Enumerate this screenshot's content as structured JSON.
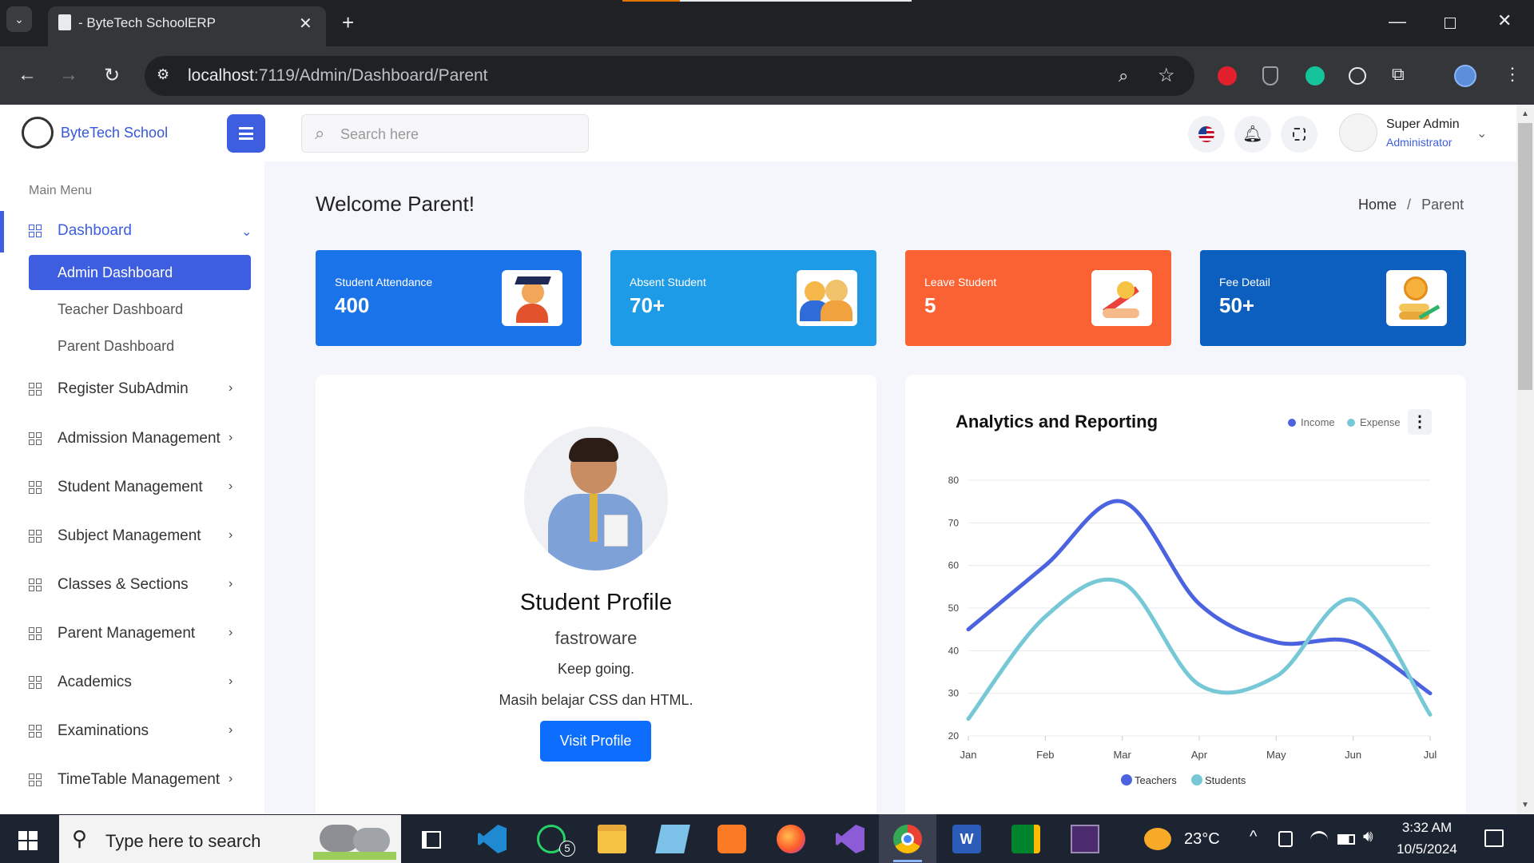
{
  "browser": {
    "tab_title": " - ByteTech SchoolERP",
    "url_host": "localhost",
    "url_path": ":7119/Admin/Dashboard/Parent"
  },
  "brand": {
    "name": "ByteTech School"
  },
  "search": {
    "placeholder": "Search here"
  },
  "user": {
    "name": "Super Admin",
    "role": "Administrator"
  },
  "sidebar": {
    "section_title": "Main Menu",
    "dashboard": {
      "label": "Dashboard",
      "subitems": [
        "Admin Dashboard",
        "Teacher Dashboard",
        "Parent Dashboard"
      ]
    },
    "items": [
      "Register SubAdmin",
      "Admission Management",
      "Student Management",
      "Subject Management",
      "Classes & Sections",
      "Parent Management",
      "Academics",
      "Examinations",
      "TimeTable Management"
    ]
  },
  "page": {
    "title": "Welcome Parent!",
    "breadcrumb_home": "Home",
    "breadcrumb_sep": "/",
    "breadcrumb_current": "Parent"
  },
  "cards": [
    {
      "label": "Student Attendance",
      "value": "400",
      "color": "#1a73e8"
    },
    {
      "label": "Absent Student",
      "value": "70+",
      "color": "#1e9be6"
    },
    {
      "label": "Leave Student",
      "value": "5",
      "color": "#fb6233"
    },
    {
      "label": "Fee Detail",
      "value": "50+",
      "color": "#0c5ebf"
    }
  ],
  "profile": {
    "title": "Student Profile",
    "name": "fastroware",
    "line1": "Keep going.",
    "line2": "Masih belajar CSS dan HTML.",
    "button": "Visit Profile"
  },
  "analytics": {
    "title": "Analytics and Reporting",
    "legend_top": [
      "Income",
      "Expense"
    ]
  },
  "chart_data": {
    "type": "line",
    "x": [
      "Jan",
      "Feb",
      "Mar",
      "Apr",
      "May",
      "Jun",
      "Jul"
    ],
    "series": [
      {
        "name": "Teachers",
        "values": [
          45,
          60,
          75,
          51,
          42,
          42,
          30
        ],
        "color": "#4c63e0"
      },
      {
        "name": "Students",
        "values": [
          24,
          48,
          56,
          32,
          34,
          52,
          25
        ],
        "color": "#76c8d6"
      }
    ],
    "yticks": [
      80,
      70,
      60,
      50,
      40,
      30,
      20
    ],
    "ylim": [
      20,
      80
    ],
    "grid": true,
    "legend": "bottom"
  },
  "taskbar": {
    "search_placeholder": "Type here to search",
    "whatsapp_badge": "5",
    "weather": "23°C",
    "time": "3:32 AM",
    "date": "10/5/2024"
  }
}
